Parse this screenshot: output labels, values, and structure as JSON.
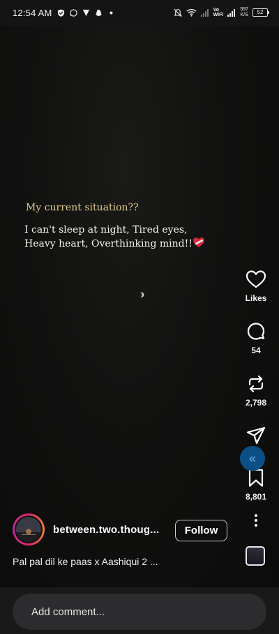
{
  "status_bar": {
    "time": "12:54 AM",
    "vowifi_top": "Vo",
    "vowifi_bottom": "WiFi",
    "net_speed_value": "597",
    "net_speed_unit": "K/S",
    "battery": "52"
  },
  "caption": {
    "title": "My current situation??",
    "line1": "I can't sleep at night, Tired eyes,",
    "line2": "Heavy heart, Overthinking mind!!"
  },
  "actions": {
    "likes_label": "Likes",
    "comments_count": "54",
    "reposts_count": "2,798",
    "saves_count": "8,801"
  },
  "collapse_glyph": "«",
  "author": {
    "username": "between.two.thoug...",
    "follow_label": "Follow"
  },
  "audio": {
    "title": "Pal pal dil ke paas x Aashiqui 2 ..."
  },
  "comment": {
    "placeholder": "Add comment..."
  }
}
